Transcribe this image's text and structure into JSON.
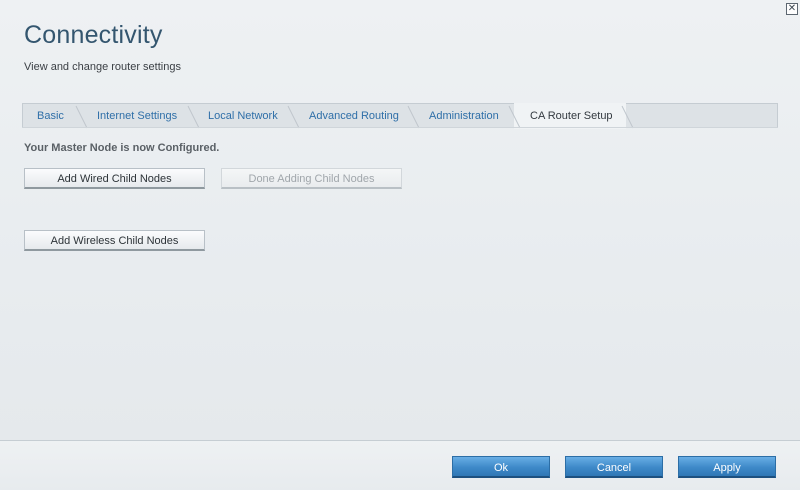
{
  "window": {
    "title": "Connectivity",
    "subtitle": "View and change router settings",
    "close_glyph": "✕"
  },
  "tabs": [
    {
      "label": "Basic",
      "active": false
    },
    {
      "label": "Internet Settings",
      "active": false
    },
    {
      "label": "Local Network",
      "active": false
    },
    {
      "label": "Advanced Routing",
      "active": false
    },
    {
      "label": "Administration",
      "active": false
    },
    {
      "label": "CA Router Setup",
      "active": true
    }
  ],
  "main": {
    "status_text": "Your Master Node is now Configured.",
    "add_wired_label": "Add Wired Child Nodes",
    "done_adding_label": "Done Adding Child Nodes",
    "add_wireless_label": "Add Wireless Child Nodes"
  },
  "footer": {
    "ok_label": "Ok",
    "cancel_label": "Cancel",
    "apply_label": "Apply"
  },
  "colors": {
    "title": "#34566f",
    "tab_link": "#2f6fa8",
    "primary_button": "#3e89c8"
  },
  "icons": {
    "close": "close-icon"
  }
}
